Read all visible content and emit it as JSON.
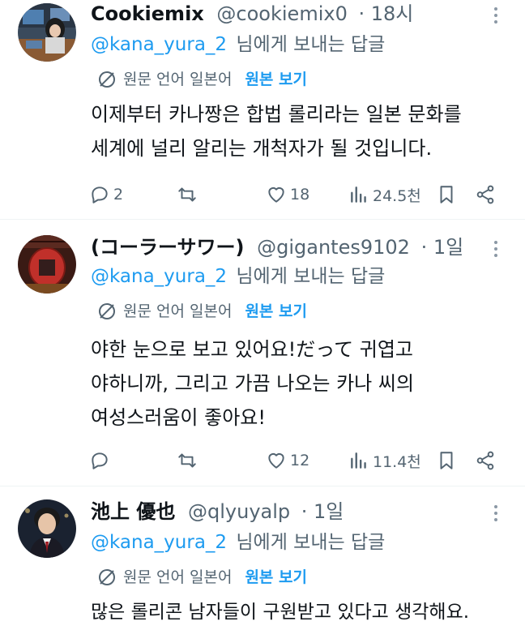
{
  "tweets": [
    {
      "display_name": "Cookiemix",
      "handle": "@cookiemix0",
      "time": "· 18시",
      "reply_to": "@kana_yura_2",
      "reply_suffix": "님에게 보내는 답글",
      "translate_lang": "원문 언어 일본어",
      "translate_link": "원본 보기",
      "body_lines": [
        "이제부터 카나짱은 합법 롤리라는 일본 문화를",
        "세계에 널리 알리는 개척자가 될 것입니다."
      ],
      "replies": "2",
      "retweets": "",
      "likes": "18",
      "views": "24.5천"
    },
    {
      "display_name": "(コーラーサワー)",
      "handle": "@gigantes9102",
      "time": "· 1일",
      "reply_to": "@kana_yura_2",
      "reply_suffix": "님에게 보내는 답글",
      "translate_lang": "원문 언어 일본어",
      "translate_link": "원본 보기",
      "body_lines": [
        "야한 눈으로 보고 있어요!だって 귀엽고",
        "야하니까, 그리고 가끔 나오는 카나 씨의",
        "여성스러움이 좋아요!"
      ],
      "replies": "",
      "retweets": "",
      "likes": "12",
      "views": "11.4천"
    },
    {
      "display_name": "池上 優也",
      "handle": "@qlyuyalp",
      "time": "· 1일",
      "reply_to": "@kana_yura_2",
      "reply_suffix": "님에게 보내는 답글",
      "translate_lang": "원문 언어 일본어",
      "translate_link": "원본 보기",
      "body_lines": [
        "많은 롤리콘 남자들이 구원받고 있다고 생각해요."
      ]
    }
  ],
  "colors": {
    "accent": "#1d9bf0",
    "secondary_text": "#536471",
    "primary_text": "#0f1419",
    "divider": "#eff3f4"
  },
  "icons": {
    "reply": "reply-icon",
    "retweet": "retweet-icon",
    "like": "heart-icon",
    "views": "views-icon",
    "bookmark": "bookmark-icon",
    "share": "share-icon",
    "translate": "translate-icon",
    "more": "more-icon"
  }
}
